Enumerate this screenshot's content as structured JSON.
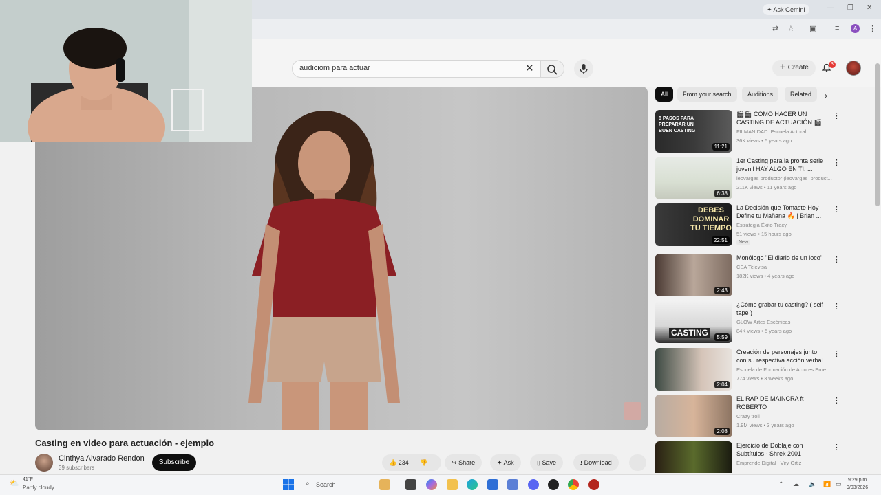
{
  "browser": {
    "ask_gemini": "Ask Gemini",
    "profile_initial": "A"
  },
  "header": {
    "search_query": "audiciom para actuar",
    "create_label": "Create",
    "notification_count": "3"
  },
  "video": {
    "title": "Casting en video para actuación - ejemplo",
    "channel": "Cinthya Alvarado Rendon",
    "subscribers": "39 subscribers",
    "subscribe_label": "Subscribe",
    "likes": "234",
    "share_label": "Share",
    "ask_label": "Ask",
    "save_label": "Save",
    "download_label": "Download"
  },
  "chips": [
    "All",
    "From your search",
    "Auditions",
    "Related"
  ],
  "recommendations": [
    {
      "title": "🎬🎬 CÓMO HACER UN CASTING DE ACTUACIÓN 🎬🎬",
      "channel": "FILMANIDAD. Escuela Actoral",
      "meta": "36K views • 5 years ago",
      "duration": "11:21",
      "thumb_text": "8 PASOS PARA PREPARAR UN BUEN CASTING"
    },
    {
      "title": "1er Casting para la pronta serie juvenil HAY ALGO EN TI. ...",
      "channel": "leovargas productor (leovargas_product...",
      "meta": "211K views • 11 years ago",
      "duration": "6:38"
    },
    {
      "title": "La Decisión que Tomaste Hoy Define tu Mañana 🔥 | Brian ...",
      "channel": "Estrategia Éxito Tracy",
      "meta": "51 views • 15 hours ago",
      "duration": "22:51",
      "badge": "New",
      "thumb_text": "DEBES DOMINAR TU TIEMPO"
    },
    {
      "title": "Monólogo \"El diario de un loco\"",
      "channel": "CEA Televisa",
      "meta": "182K views • 4 years ago",
      "duration": "2:43"
    },
    {
      "title": "¿Cómo grabar tu casting? ( self tape )",
      "channel": "GLOW Artes Escénicas",
      "meta": "84K views • 5 years ago",
      "duration": "5:59",
      "thumb_text": "CASTING"
    },
    {
      "title": "Creación de personajes junto con su respectiva acción verbal.",
      "channel": "Escuela de Formación de Actores Ernest...",
      "meta": "774 views • 3 weeks ago",
      "duration": "2:04"
    },
    {
      "title": "EL RAP DE MAINCRA ft ROBERTO",
      "channel": "Crazy troll",
      "meta": "1.9M views • 3 years ago",
      "duration": "2:08"
    },
    {
      "title": "Ejercicio de Doblaje con Subtítulos - Shrek 2001",
      "channel": "Emprende Digital | Viry Ortiz",
      "meta": "",
      "duration": ""
    }
  ],
  "taskbar": {
    "weather_temp": "41°F",
    "weather_desc": "Partly cloudy",
    "search_label": "Search",
    "time": "9:29 p.m.",
    "date": "9/03/2026"
  },
  "colors": {
    "accent_red": "#e53935",
    "dark": "#0f0f0f"
  }
}
